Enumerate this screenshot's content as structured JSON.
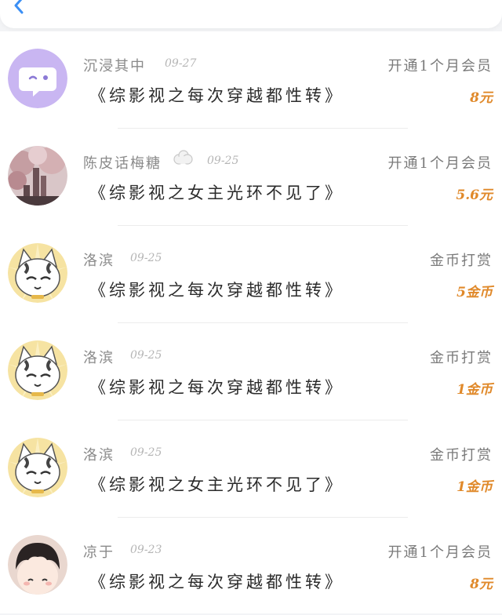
{
  "header": {
    "back_icon": "chevron-left-icon",
    "accent": "#3b8ff5"
  },
  "colors": {
    "amount": "#e0892a",
    "name": "#8a8a8a"
  },
  "items": [
    {
      "name": "沉浸其中",
      "date": "09-27",
      "type": "开通1个月会员",
      "title": "《综影视之每次穿越都性转》",
      "amount": "8元",
      "avatar": "purple-chat-bubble-avatar"
    },
    {
      "name": "陈皮话梅糖",
      "date": "09-25",
      "type": "开通1个月会员",
      "title": "《综影视之女主光环不见了》",
      "amount": "5.6元",
      "avatar": "blossom-tower-photo-avatar",
      "badge": "cloud-badge-icon"
    },
    {
      "name": "洛滨",
      "date": "09-25",
      "type": "金币打赏",
      "title": "《综影视之每次穿越都性转》",
      "amount": "5金币",
      "avatar": "cat-avatar"
    },
    {
      "name": "洛滨",
      "date": "09-25",
      "type": "金币打赏",
      "title": "《综影视之每次穿越都性转》",
      "amount": "1金币",
      "avatar": "cat-avatar"
    },
    {
      "name": "洛滨",
      "date": "09-25",
      "type": "金币打赏",
      "title": "《综影视之女主光环不见了》",
      "amount": "1金币",
      "avatar": "cat-avatar"
    },
    {
      "name": "凉于",
      "date": "09-23",
      "type": "开通1个月会员",
      "title": "《综影视之每次穿越都性转》",
      "amount": "8元",
      "avatar": "cartoon-boy-avatar"
    }
  ]
}
